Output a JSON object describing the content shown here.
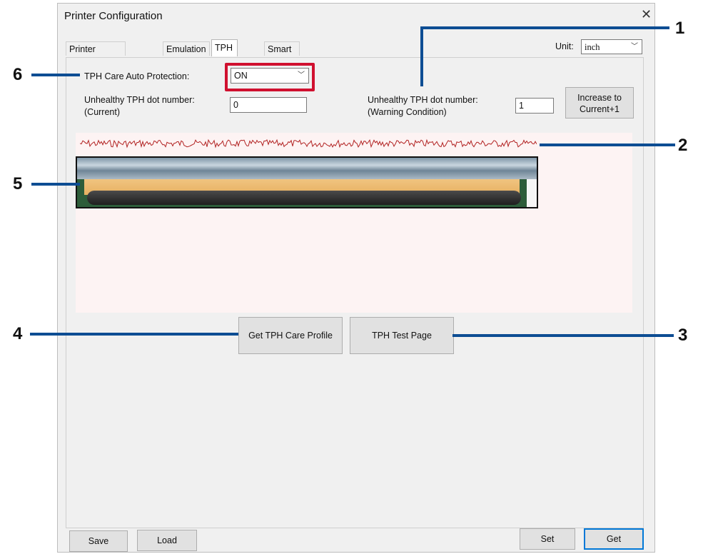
{
  "window": {
    "title": "Printer Configuration",
    "close_glyph": "✕"
  },
  "tabs": [
    {
      "label": "Printer Configuration",
      "active": false
    },
    {
      "label": "Emulation",
      "active": false
    },
    {
      "label": "TPH Care",
      "active": true
    },
    {
      "label": "Smart Battery",
      "active": false
    }
  ],
  "unit": {
    "label": "Unit:",
    "value": "inch"
  },
  "tph": {
    "auto_protection_label": "TPH Care Auto Protection:",
    "auto_protection_value": "ON",
    "current_label_line1": "Unhealthy TPH dot number:",
    "current_label_line2": "(Current)",
    "current_value": "0",
    "warning_label_line1": "Unhealthy TPH dot number:",
    "warning_label_line2": "(Warning Condition)",
    "warning_value": "1",
    "increase_line1": "Increase to",
    "increase_line2": "Current+1"
  },
  "buttons": {
    "profile": "Get TPH Care Profile",
    "test_page": "TPH Test Page",
    "save": "Save",
    "load": "Load",
    "set": "Set",
    "get": "Get"
  },
  "callouts": [
    "1",
    "2",
    "3",
    "4",
    "5",
    "6"
  ],
  "colors": {
    "callout_line": "#0d4d93",
    "highlight": "#d0102f",
    "waveform": "#b22222"
  }
}
